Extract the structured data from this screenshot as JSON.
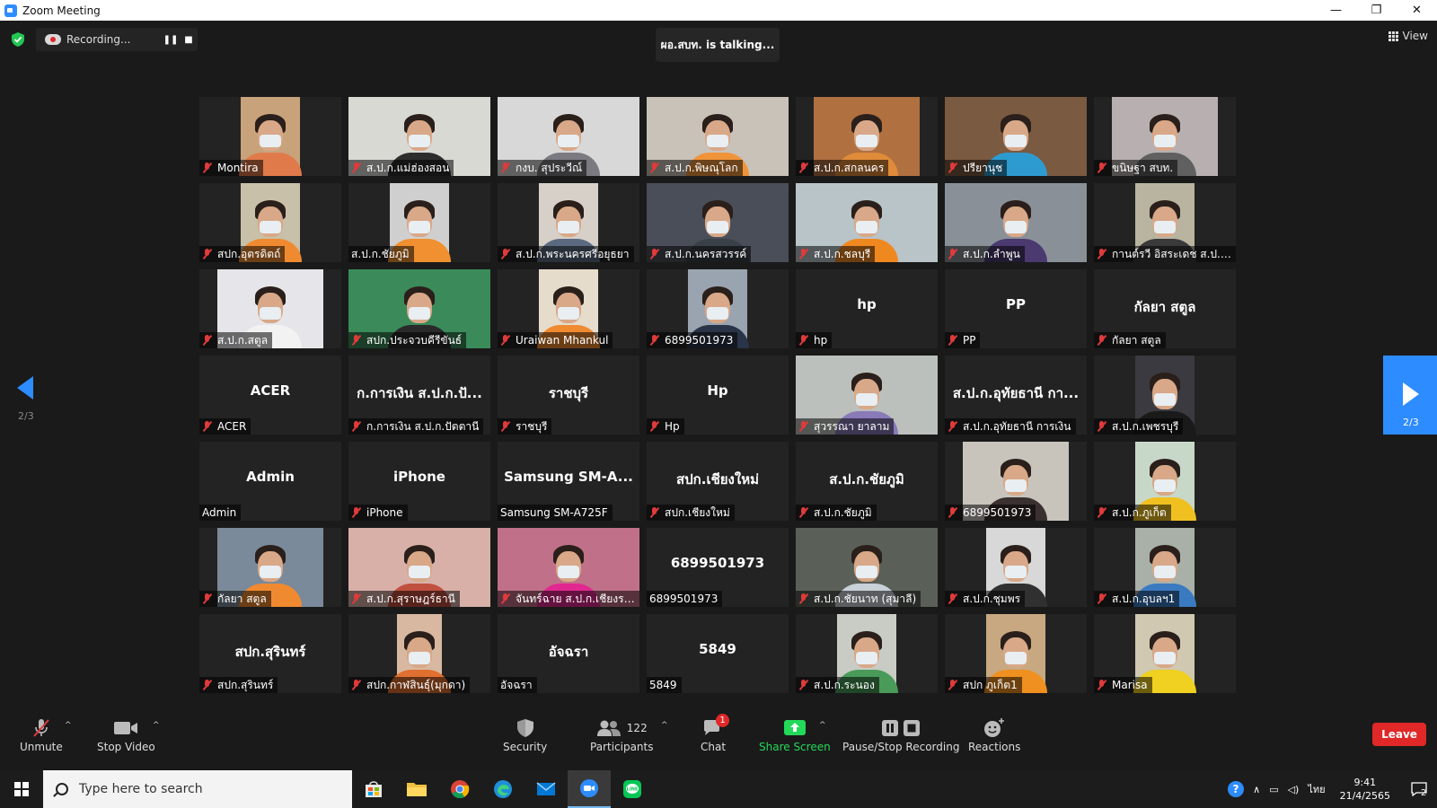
{
  "window": {
    "title": "Zoom Meeting",
    "controls": [
      "—",
      "❐",
      "✕"
    ]
  },
  "topbar": {
    "recording_text": "Recording...",
    "talking_text": "ผอ.สบท. is talking...",
    "view_label": "View"
  },
  "pagination": {
    "prev_page": "2/3",
    "next_page": "2/3"
  },
  "tiles": [
    {
      "name": "Montira",
      "video": true,
      "muted": true,
      "bg": "#c8a27a",
      "w": 66,
      "body": "#e07a4a"
    },
    {
      "name": "ส.ป.ก.แม่ฮ่องสอน",
      "video": true,
      "muted": true,
      "bg": "#d9d9d4",
      "w": 158,
      "body": "#2d2d2d"
    },
    {
      "name": "กงบ. สุประวีณ์",
      "video": true,
      "muted": true,
      "bg": "#d8d8d8",
      "w": 158,
      "body": "#7a7a80"
    },
    {
      "name": "ส.ป.ก.พิษณุโลก",
      "video": true,
      "muted": true,
      "bg": "#c9c2b8",
      "w": 158,
      "body": "#f0943a"
    },
    {
      "name": "ส.ป.ก.สกลนคร",
      "video": true,
      "muted": true,
      "bg": "#b07040",
      "w": 118,
      "body": "#e08b3a"
    },
    {
      "name": "ปรียานุช",
      "video": true,
      "muted": true,
      "bg": "#7a5a40",
      "w": 158,
      "body": "#2e9bd0"
    },
    {
      "name": "ขนิษฐา สบท.",
      "video": true,
      "muted": true,
      "bg": "#b8b0b0",
      "w": 118,
      "body": "#606060"
    },
    {
      "name": "สปก.อุตรดิตถ์",
      "video": true,
      "muted": true,
      "bg": "#c8c0a8",
      "w": 66,
      "body": "#f08a30"
    },
    {
      "name": "ส.ป.ก.ชัยภูมิ",
      "video": true,
      "muted": false,
      "bg": "#d0cfcf",
      "w": 66,
      "body": "#f09030"
    },
    {
      "name": "ส.ป.ก.พระนครศรีอยุธยา",
      "video": true,
      "muted": true,
      "bg": "#d6d0c8",
      "w": 66,
      "body": "#5b6a80"
    },
    {
      "name": "ส.ป.ก.นครสวรรค์",
      "video": true,
      "muted": true,
      "bg": "#4a4e58",
      "w": 158,
      "body": "#3a4048"
    },
    {
      "name": "ส.ป.ก.ชลบุรี",
      "video": true,
      "muted": true,
      "bg": "#b8c4c8",
      "w": 158,
      "body": "#f08820"
    },
    {
      "name": "ส.ป.ก.ลำพูน",
      "video": true,
      "muted": true,
      "bg": "#8a9098",
      "w": 158,
      "body": "#4a3a70"
    },
    {
      "name": "กานต์รวี อิสระเดช ส.ป.ก....",
      "video": true,
      "muted": true,
      "bg": "#b8b4a0",
      "w": 66,
      "body": "#3a3a3a"
    },
    {
      "name": "ส.ป.ก.สตูล",
      "video": true,
      "muted": true,
      "bg": "#e6e6ea",
      "w": 118,
      "body": "#f2f2f2"
    },
    {
      "name": "สปก.ประจวบคีรีขันธ์",
      "video": true,
      "muted": true,
      "bg": "#3a8a5a",
      "w": 158,
      "body": "#2a2a2a"
    },
    {
      "name": "Uraiwan Mhankul",
      "video": true,
      "muted": true,
      "bg": "#e6dccc",
      "w": 66,
      "body": "#f08a30"
    },
    {
      "name": "6899501973",
      "video": true,
      "muted": true,
      "bg": "#9aa4b0",
      "w": 66,
      "body": "#2a3448"
    },
    {
      "name": "hp",
      "video": false,
      "muted": true,
      "big": "hp"
    },
    {
      "name": "PP",
      "video": false,
      "muted": true,
      "big": "PP"
    },
    {
      "name": "กัลยา สตูล",
      "video": false,
      "muted": true,
      "big": "กัลยา สตูล"
    },
    {
      "name": "ACER",
      "video": false,
      "muted": true,
      "big": "ACER"
    },
    {
      "name": "ก.การเงิน ส.ป.ก.ปัตตานี",
      "video": false,
      "muted": true,
      "big": "ก.การเงิน ส.ป.ก.ปั..."
    },
    {
      "name": "ราชบุรี",
      "video": false,
      "muted": true,
      "big": "ราชบุรี"
    },
    {
      "name": "Hp",
      "video": false,
      "muted": true,
      "big": "Hp"
    },
    {
      "name": "สุวรรณา ยาลาม",
      "video": true,
      "muted": true,
      "bg": "#bcc0bc",
      "w": 158,
      "body": "#8a7ab8"
    },
    {
      "name": "ส.ป.ก.อุทัยธานี การเงิน",
      "video": false,
      "muted": true,
      "big": "ส.ป.ก.อุทัยธานี กา..."
    },
    {
      "name": "ส.ป.ก.เพชรบุรี",
      "video": true,
      "muted": true,
      "bg": "#3a3a40",
      "w": 66,
      "body": "#1a1a1a"
    },
    {
      "name": "Admin",
      "video": false,
      "muted": false,
      "big": "Admin"
    },
    {
      "name": "iPhone",
      "video": false,
      "muted": true,
      "big": "iPhone"
    },
    {
      "name": "Samsung SM-A725F",
      "video": false,
      "muted": false,
      "big": "Samsung SM-A..."
    },
    {
      "name": "สปก.เชียงใหม่",
      "video": false,
      "muted": true,
      "big": "สปก.เชียงใหม่"
    },
    {
      "name": "ส.ป.ก.ชัยภูมิ",
      "video": false,
      "muted": true,
      "big": "ส.ป.ก.ชัยภูมิ"
    },
    {
      "name": "6899501973",
      "video": true,
      "muted": true,
      "bg": "#c8c4bc",
      "w": 118,
      "body": "#3a3030"
    },
    {
      "name": "ส.ป.ก.ภูเก็ต",
      "video": true,
      "muted": true,
      "bg": "#c8d8c8",
      "w": 66,
      "body": "#f0c020"
    },
    {
      "name": "กัลยา สตูล",
      "video": true,
      "muted": true,
      "bg": "#7a8a9a",
      "w": 118,
      "body": "#f08a30"
    },
    {
      "name": "ส.ป.ก.สุราษฎร์ธานี",
      "video": true,
      "muted": true,
      "bg": "#d8b0a8",
      "w": 158,
      "body": "#c05040"
    },
    {
      "name": "จันทร์ฉาย ส.ป.ก.เชียงราย",
      "video": true,
      "muted": true,
      "bg": "#c07088",
      "w": 158,
      "body": "#e02890"
    },
    {
      "name": "6899501973",
      "video": false,
      "muted": false,
      "big": "6899501973"
    },
    {
      "name": "ส.ป.ก.ชัยนาท (สุมาลี)",
      "video": true,
      "muted": true,
      "bg": "#5a6058",
      "w": 158,
      "body": "#c8d0d8"
    },
    {
      "name": "ส.ป.ก.ชุมพร",
      "video": true,
      "muted": true,
      "bg": "#d8d8d8",
      "w": 66,
      "body": "#303030"
    },
    {
      "name": "ส.ป.ก.อุบลฯ1",
      "video": true,
      "muted": true,
      "bg": "#a8b0a8",
      "w": 66,
      "body": "#3a7ac0"
    },
    {
      "name": "สปก.สุรินทร์",
      "video": false,
      "muted": true,
      "big": "สปก.สุรินทร์"
    },
    {
      "name": "สปก.กาฬสินธุ์(มุกดา)",
      "video": true,
      "muted": true,
      "bg": "#d8b8a0",
      "w": 50,
      "body": "#e07030"
    },
    {
      "name": "อัจฉรา",
      "video": false,
      "muted": false,
      "big": "อัจฉรา"
    },
    {
      "name": "5849",
      "video": false,
      "muted": false,
      "big": "5849"
    },
    {
      "name": "ส.ป.ก.ระนอง",
      "video": true,
      "muted": true,
      "bg": "#c8ccc4",
      "w": 66,
      "body": "#4a9a5a"
    },
    {
      "name": "สปก ภูเก็ต1",
      "video": true,
      "muted": true,
      "bg": "#c8a880",
      "w": 66,
      "body": "#f09020"
    },
    {
      "name": "Marisa",
      "video": true,
      "muted": true,
      "bg": "#d0c8b0",
      "w": 66,
      "body": "#f0d020"
    }
  ],
  "toolbar": {
    "unmute": "Unmute",
    "stop_video": "Stop Video",
    "security": "Security",
    "participants": "Participants",
    "participants_count": "122",
    "chat": "Chat",
    "chat_badge": "1",
    "share_screen": "Share Screen",
    "pause_stop_recording": "Pause/Stop Recording",
    "reactions": "Reactions",
    "leave": "Leave"
  },
  "taskbar": {
    "search_placeholder": "Type here to search",
    "lang": "ไทย",
    "time": "9:41",
    "date": "21/4/2565",
    "notif_count": "2"
  },
  "colors": {
    "accent": "#2d8cff",
    "leave": "#e02828",
    "share": "#23d959",
    "mute": "#e03a3a"
  }
}
